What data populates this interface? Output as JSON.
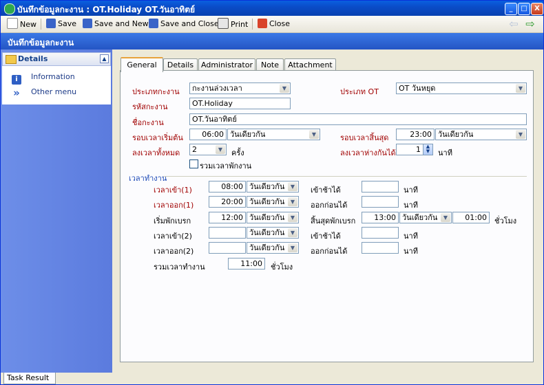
{
  "window": {
    "title": "บันทึกข้อมูลกะงาน : OT.Holiday OT.วันอาทิตย์",
    "min_symbol": "_",
    "max_symbol": "□",
    "close_symbol": "X"
  },
  "toolbar": {
    "new": "New",
    "save": "Save",
    "save_and_new": "Save and New",
    "save_and_close": "Save and Close",
    "print": "Print",
    "close": "Close",
    "back_symbol": "⇦",
    "forward_symbol": "⇨"
  },
  "header": {
    "title": "บันทึกข้อมูลกะงาน"
  },
  "left_panel": {
    "title": "Details",
    "collapse_symbol": "▲",
    "items": [
      {
        "label": "Information",
        "icon": "info-icon",
        "icon_glyph": "i"
      },
      {
        "label": "Other menu",
        "icon": "double-chevron-down-icon",
        "icon_glyph": "»"
      }
    ]
  },
  "tabs": [
    "General",
    "Details",
    "Administrator",
    "Note",
    "Attachment"
  ],
  "active_tab": "General",
  "form": {
    "shift_type_label": "ประเภทกะงาน",
    "shift_type_value": "กะงานล่วงเวลา",
    "ot_type_label": "ประเภท OT",
    "ot_type_value": "OT วันหยุด",
    "shift_code_label": "รหัสกะงาน",
    "shift_code_value": "OT.Holiday",
    "shift_name_label": "ชื่อกะงาน",
    "shift_name_value": "OT.วันอาทิตย์",
    "start_label": "รอบเวลาเริ่มต้น",
    "start_time": "06:00",
    "start_day": "วันเดียวกัน",
    "end_label": "รอบเวลาสิ้นสุด",
    "end_time": "23:00",
    "end_day": "วันเดียวกัน",
    "total_punch_label": "ลงเวลาทั้งหมด",
    "total_punch_value": "2",
    "total_punch_unit": "ครั้ง",
    "punch_gap_label": "ลงเวลาห่างกันได้",
    "punch_gap_value": "1",
    "punch_gap_unit": "นาที",
    "include_break_label": "รวมเวลาพักงาน",
    "include_break_checked": false
  },
  "work_time": {
    "group_label": "เวลาทำงาน",
    "rows": [
      {
        "label": "เวลาเข้า(1)",
        "required": true,
        "time": "08:00",
        "day": "วันเดียวกัน",
        "side_label": "เข้าช้าได้",
        "side_value": "",
        "unit": "นาที"
      },
      {
        "label": "เวลาออก(1)",
        "required": true,
        "time": "20:00",
        "day": "วันเดียวกัน",
        "side_label": "ออกก่อนได้",
        "side_value": "",
        "unit": "นาที"
      },
      {
        "label": "เริ่มพักเบรก",
        "required": false,
        "time": "12:00",
        "day": "วันเดียวกัน",
        "side_label": "สิ้นสุดพักเบรก",
        "side_value": "13:00",
        "side_day": "วันเดียวกัน",
        "duration": "01:00",
        "unit": "ชั่วโมง"
      },
      {
        "label": "เวลาเข้า(2)",
        "required": false,
        "time": "",
        "day": "วันเดียวกัน",
        "side_label": "เข้าช้าได้",
        "side_value": "",
        "unit": "นาที"
      },
      {
        "label": "เวลาออก(2)",
        "required": false,
        "time": "",
        "day": "วันเดียวกัน",
        "side_label": "ออกก่อนได้",
        "side_value": "",
        "unit": "นาที"
      }
    ],
    "total_label": "รวมเวลาทำงาน",
    "total_value": "11:00",
    "total_unit": "ชั่วโมง"
  },
  "task_result": "Task Result",
  "colors": {
    "title_bar": "#0842b0",
    "header_band": "#2a5fcf",
    "left_panel": "#6384e4",
    "required_label": "#a00000",
    "active_tab_accent": "#e8a33a"
  }
}
